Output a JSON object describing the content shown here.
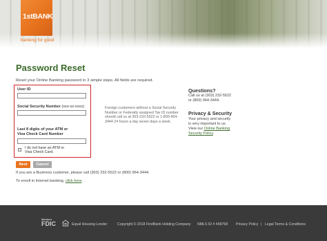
{
  "brand": {
    "logo_text": "1stBANK",
    "tagline": "banking for good",
    "colors": {
      "orange": "#e8731e",
      "green": "#3b6a2a",
      "error_red": "#cc2222",
      "footer_bg": "#3a3a3a"
    }
  },
  "page": {
    "title": "Password Reset",
    "intro": "Reset your Online Banking password in 3 simple steps. All fields are required."
  },
  "form": {
    "user_id_label": "User ID",
    "ssn_label": "Social Security Number",
    "ssn_hint": "(xxx-xx-xxxx)",
    "card_label_line1": "Last 8 digits of your ATM or",
    "card_label_line2": "Visa Check Card Number",
    "no_card_label_line1": "I do not have an ATM or",
    "no_card_label_line2": "Visa Check Card.",
    "user_id_value": "",
    "ssn_value": "",
    "card_value": "",
    "no_card_checked": false
  },
  "foreign_note": "Foreign customers without a Social Security Number or Federally assigned Tax ID number should call us at 303-232-5522 or 1-800-964-3444 24 hours a day seven days a week.",
  "sidebar": {
    "questions_heading": "Questions?",
    "questions_line1": "Call us at (303) 232-5522",
    "questions_line2": "or (800) 964-3444.",
    "privacy_heading": "Privacy & Security",
    "privacy_line1": "Your privacy and security",
    "privacy_line2": "is very important to us.",
    "privacy_line3": "View our",
    "privacy_link1": "Online Banking",
    "privacy_link2": "Security Policy",
    "privacy_line3_end": "."
  },
  "buttons": {
    "next": "Next",
    "cancel": "Cancel"
  },
  "notes": {
    "business": "If you are a Business customer, please call (303) 232-5522 or (800) 964-3444.",
    "enroll": "To enroll in Internet banking,",
    "enroll_link": "click here",
    "enroll_end": "."
  },
  "footer": {
    "fdic_top": "Member",
    "fdic_main": "FDIC",
    "equal_housing": "Equal Housing Lender",
    "copyright": "Copyright © 2018 FirstBank Holding Company",
    "nmls": "NMLS ID # 458768",
    "privacy_policy": "Privacy Policy",
    "legal_sep": "|",
    "legal_terms": "Legal Terms & Conditions"
  }
}
